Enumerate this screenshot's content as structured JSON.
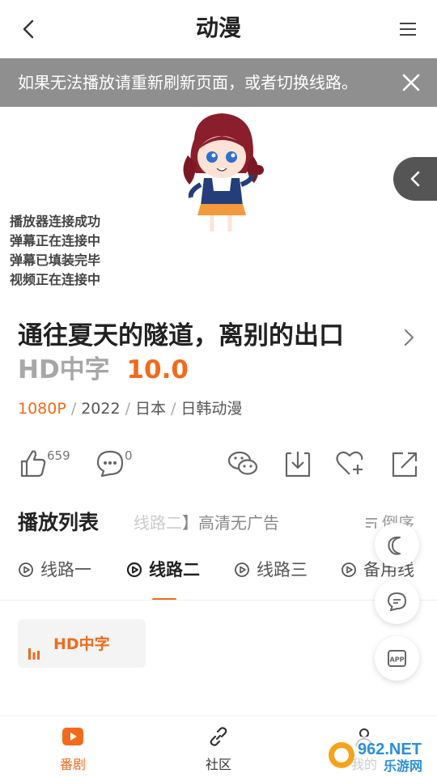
{
  "header": {
    "title": "动漫",
    "back_icon": "chevron-left-icon",
    "menu_icon": "hamburger-menu-icon"
  },
  "notice": {
    "text": "如果无法播放请重新刷新页面，或者切换线路。",
    "close_icon": "close-icon"
  },
  "player": {
    "status_lines": [
      "播放器连接成功",
      "弹幕正在连接中",
      "弹幕已填装完毕",
      "视频正在连接中"
    ],
    "side_tab_icon": "chevron-left-icon"
  },
  "show": {
    "title": "通往夏天的隧道，离别的出口",
    "badge": "HD中字",
    "score": "10.0",
    "quality": "1080P",
    "year": "2022",
    "region": "日本",
    "category": "日韩动漫"
  },
  "actions": {
    "like_count": "659",
    "comment_count": "0"
  },
  "playlist": {
    "title": "播放列表",
    "subtitle_fade": "线路二",
    "subtitle": "】高清无广告",
    "sort_label": "倒序",
    "routes": [
      "线路一",
      "线路二",
      "线路三",
      "备用线"
    ],
    "active_route": 1,
    "episodes": [
      "HD中字"
    ]
  },
  "bottom_nav": {
    "items": [
      {
        "label": "番剧",
        "icon": "play-icon"
      },
      {
        "label": "社区",
        "icon": "link-icon"
      },
      {
        "label": "我的",
        "icon": "user-icon"
      }
    ],
    "active": 0
  },
  "watermark": {
    "text_top": "962.NET",
    "text_bottom": "乐游网"
  },
  "colors": {
    "accent": "#f26a1b",
    "notice_bg": "#8f8f8f"
  }
}
